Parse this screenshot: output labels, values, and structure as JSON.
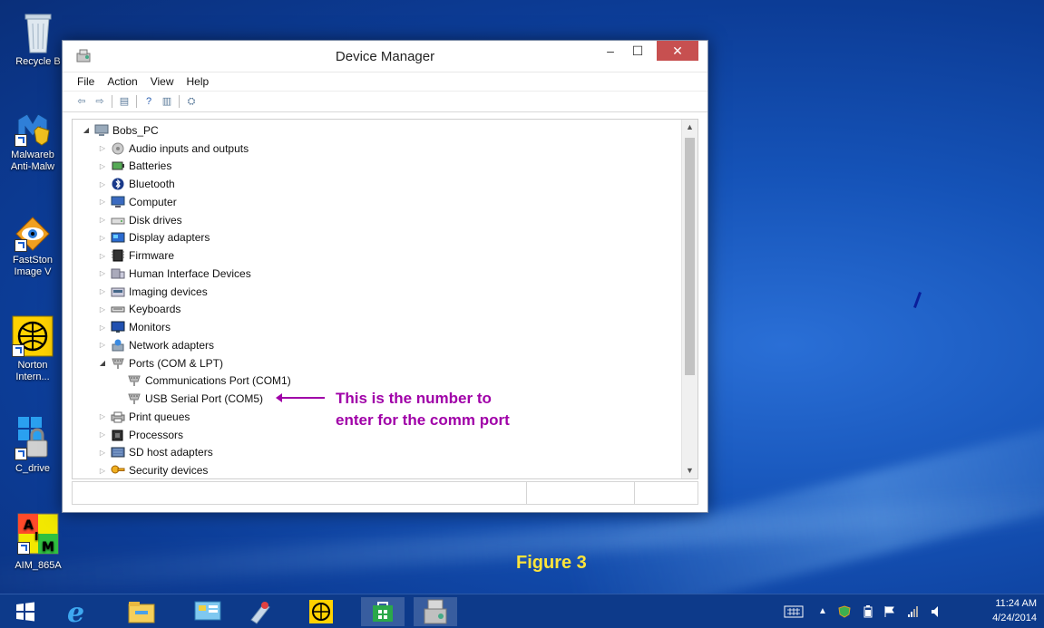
{
  "desktop": {
    "icons": [
      {
        "label": "Recycle B",
        "icon": "recycle-bin-icon"
      },
      {
        "label": "Malwareb Anti-Malw",
        "line1": "Malwareb",
        "line2": "Anti-Malw",
        "icon": "malwarebytes-icon"
      },
      {
        "label": "FastSton Image V",
        "line1": "FastSton",
        "line2": "Image V",
        "icon": "faststone-icon"
      },
      {
        "label": "Norton Intern...",
        "line1": "Norton",
        "line2": "Intern...",
        "icon": "norton-icon"
      },
      {
        "label": "C_drive",
        "icon": "c-drive-icon"
      },
      {
        "label": "AIM_865A",
        "icon": "aim-icon"
      }
    ]
  },
  "window": {
    "title": "Device Manager",
    "controls": {
      "minimize": "–",
      "maximize": "☐",
      "close": "✕"
    },
    "menu": [
      "File",
      "Action",
      "View",
      "Help"
    ],
    "tree": {
      "root": "Bobs_PC",
      "nodes": [
        {
          "label": "Audio inputs and outputs",
          "icon": "speaker-icon",
          "expanded": false
        },
        {
          "label": "Batteries",
          "icon": "battery-icon",
          "expanded": false
        },
        {
          "label": "Bluetooth",
          "icon": "bluetooth-icon",
          "expanded": false
        },
        {
          "label": "Computer",
          "icon": "computer-icon",
          "expanded": false
        },
        {
          "label": "Disk drives",
          "icon": "disk-drive-icon",
          "expanded": false
        },
        {
          "label": "Display adapters",
          "icon": "display-adapter-icon",
          "expanded": false
        },
        {
          "label": "Firmware",
          "icon": "firmware-icon",
          "expanded": false
        },
        {
          "label": "Human Interface Devices",
          "icon": "hid-icon",
          "expanded": false
        },
        {
          "label": "Imaging devices",
          "icon": "camera-icon",
          "expanded": false
        },
        {
          "label": "Keyboards",
          "icon": "keyboard-icon",
          "expanded": false
        },
        {
          "label": "Monitors",
          "icon": "monitor-icon",
          "expanded": false
        },
        {
          "label": "Network adapters",
          "icon": "network-icon",
          "expanded": false
        },
        {
          "label": "Ports (COM & LPT)",
          "icon": "port-icon",
          "expanded": true
        },
        {
          "label": "Communications Port (COM1)",
          "icon": "port-icon",
          "child": true
        },
        {
          "label": "USB Serial Port (COM5)",
          "icon": "port-icon",
          "child": true
        },
        {
          "label": "Print queues",
          "icon": "printer-icon",
          "expanded": false
        },
        {
          "label": "Processors",
          "icon": "processor-icon",
          "expanded": false
        },
        {
          "label": "SD host adapters",
          "icon": "sd-card-icon",
          "expanded": false
        },
        {
          "label": "Security devices",
          "icon": "security-icon",
          "expanded": false
        }
      ]
    }
  },
  "annotation": {
    "line1": "This is the number to",
    "line2": "enter for the comm port",
    "color": "#a000a8"
  },
  "figure_label": "Figure 3",
  "taskbar": {
    "apps": [
      "start-icon",
      "ie-icon",
      "file-explorer-icon",
      "control-panel-icon",
      "paint-icon",
      "norton-icon",
      "store-icon",
      "device-manager-icon"
    ],
    "clock": {
      "time": "11:24 AM",
      "date": "4/24/2014"
    }
  },
  "colors": {
    "accent": "#1553b8",
    "annotation": "#a000a8",
    "figure": "#ffe43a"
  }
}
